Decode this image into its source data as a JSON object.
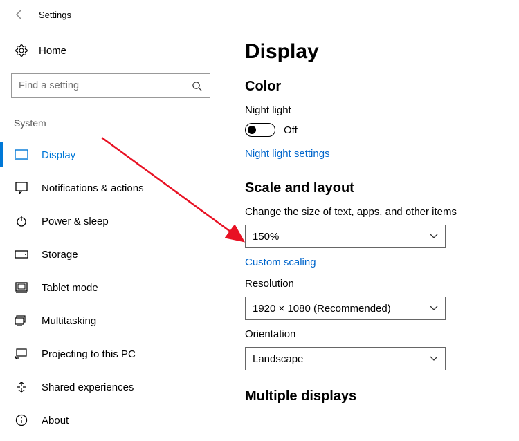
{
  "header": {
    "title": "Settings"
  },
  "home": {
    "label": "Home"
  },
  "search": {
    "placeholder": "Find a setting"
  },
  "section_label": "System",
  "nav": [
    {
      "label": "Display",
      "active": true
    },
    {
      "label": "Notifications & actions"
    },
    {
      "label": "Power & sleep"
    },
    {
      "label": "Storage"
    },
    {
      "label": "Tablet mode"
    },
    {
      "label": "Multitasking"
    },
    {
      "label": "Projecting to this PC"
    },
    {
      "label": "Shared experiences"
    },
    {
      "label": "About"
    }
  ],
  "main": {
    "title": "Display",
    "color_section": "Color",
    "night_light_label": "Night light",
    "night_light_state": "Off",
    "night_light_link": "Night light settings",
    "scale_section": "Scale and layout",
    "scale_label": "Change the size of text, apps, and other items",
    "scale_value": "150%",
    "custom_scaling_link": "Custom scaling",
    "resolution_label": "Resolution",
    "resolution_value": "1920 × 1080 (Recommended)",
    "orientation_label": "Orientation",
    "orientation_value": "Landscape",
    "multiple_section": "Multiple displays"
  }
}
